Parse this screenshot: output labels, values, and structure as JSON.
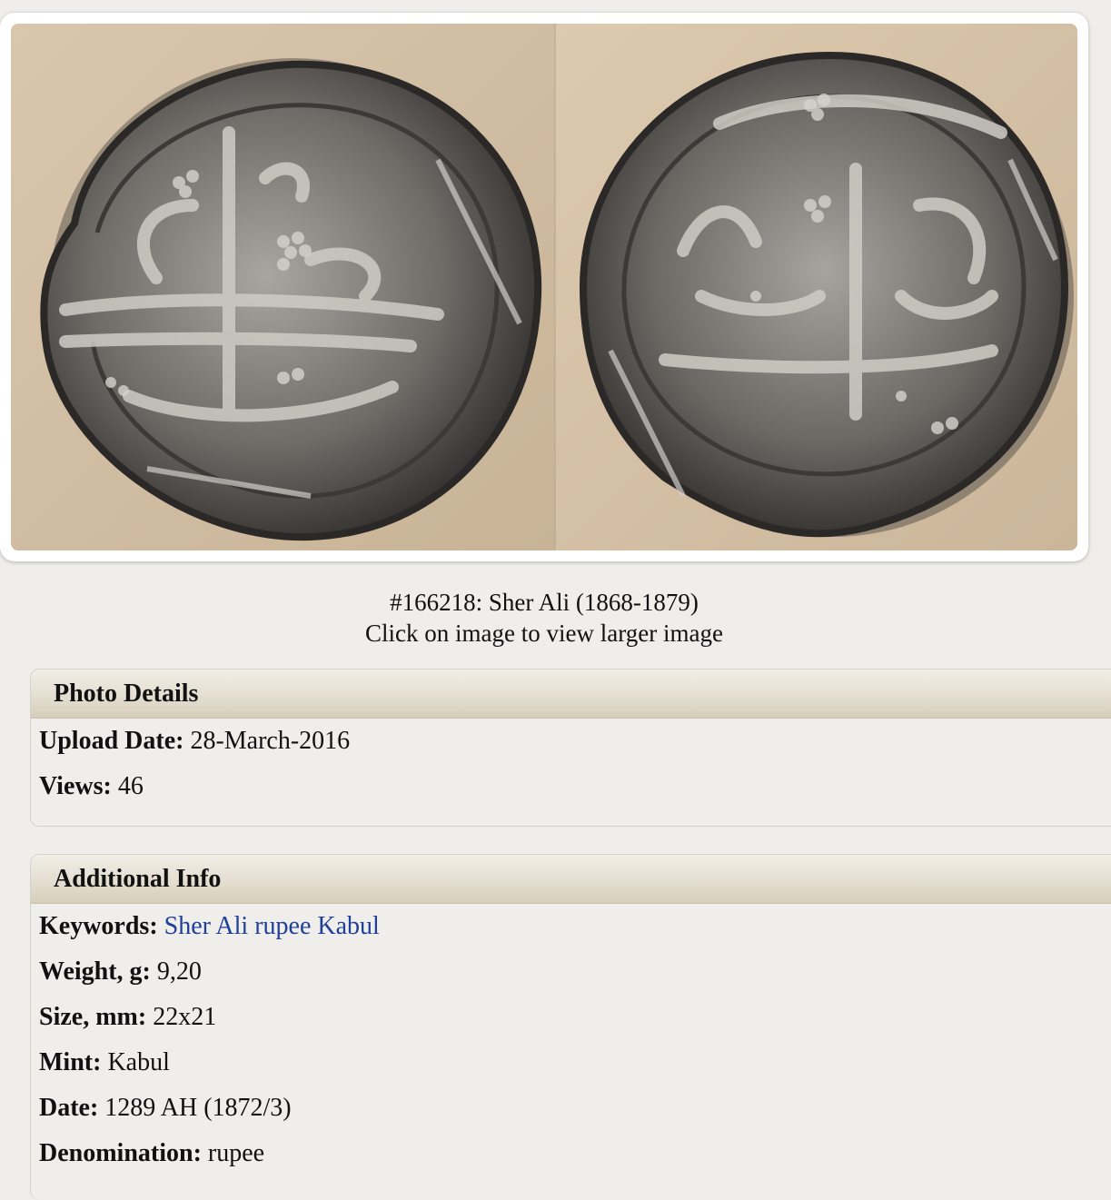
{
  "photo": {
    "caption_title": "#166218: Sher Ali (1868-1879)",
    "caption_hint": "Click on image to view larger image"
  },
  "photo_details": {
    "heading": "Photo Details",
    "upload_date_label": "Upload Date:",
    "upload_date_value": "28-March-2016",
    "views_label": "Views:",
    "views_value": "46"
  },
  "additional_info": {
    "heading": "Additional Info",
    "keywords_label": "Keywords:",
    "keywords_value": "Sher Ali rupee Kabul",
    "weight_label": "Weight, g:",
    "weight_value": "9,20",
    "size_label": "Size, mm:",
    "size_value": "22x21",
    "mint_label": "Mint:",
    "mint_value": "Kabul",
    "date_label": "Date:",
    "date_value": "1289 AH (1872/3)",
    "denomination_label": "Denomination:",
    "denomination_value": "rupee"
  },
  "colors": {
    "background": "#efeeeb",
    "link": "#1f3f9a",
    "panel_header": "#e3ddcf"
  }
}
